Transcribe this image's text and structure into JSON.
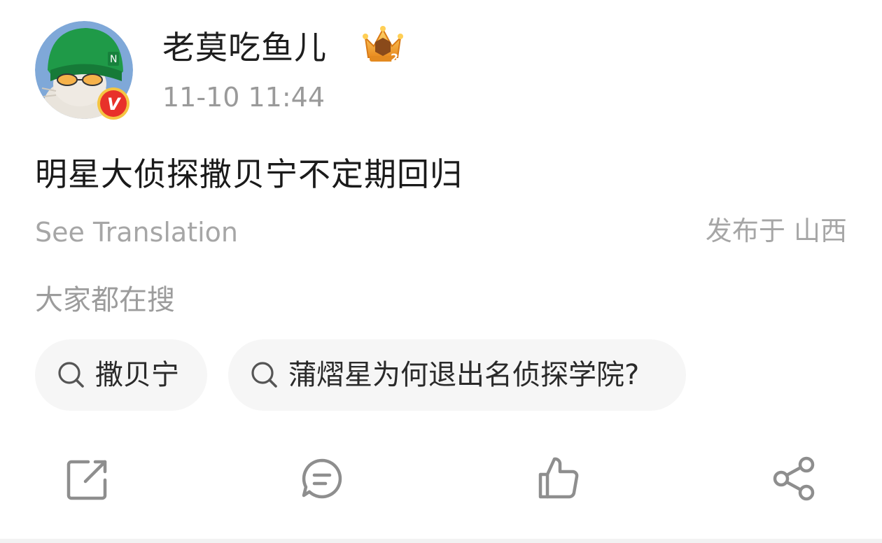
{
  "user": {
    "name": "老莫吃鱼儿",
    "timestamp": "11-10 11:44",
    "verified_icon": "verified-v-badge",
    "rank_icon": "crown-rank-2-badge",
    "rank_number": "2"
  },
  "post": {
    "text": "明星大侦探撒贝宁不定期回归",
    "see_translation": "See Translation",
    "location": "发布于 山西"
  },
  "trending": {
    "label": "大家都在搜",
    "items": [
      {
        "icon": "search-icon",
        "label": "撒贝宁"
      },
      {
        "icon": "search-icon",
        "label": "蒲熠星为何退出名侦探学院?"
      }
    ]
  },
  "actions": [
    {
      "name": "repost",
      "icon": "repost-icon"
    },
    {
      "name": "comment",
      "icon": "comment-icon"
    },
    {
      "name": "like",
      "icon": "like-icon"
    },
    {
      "name": "share",
      "icon": "share-icon"
    }
  ],
  "colors": {
    "primary_text": "#1a1a1a",
    "secondary_text": "#a6a6a6",
    "chip_background": "#f6f6f6",
    "icon_gray": "#8e8e8e",
    "verified_red": "#e8312a",
    "crown_gold": "#f0a638"
  }
}
